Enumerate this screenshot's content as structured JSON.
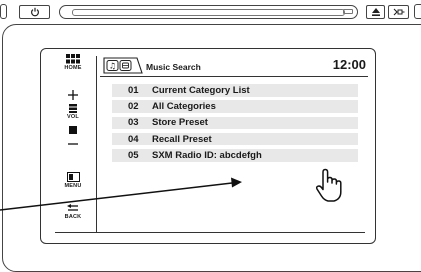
{
  "screen": {
    "header": {
      "title": "Music Search",
      "clock": "12:00"
    },
    "left_menu": [
      {
        "label": "HOME",
        "icon": "home-grid-icon"
      },
      {
        "label": "",
        "icon": "volume-up-icon"
      },
      {
        "label": "VOL",
        "icon": "volume-bars-icon"
      },
      {
        "label": "",
        "icon": "volume-down-icon"
      },
      {
        "label": "MENU",
        "icon": "menu-icon"
      },
      {
        "label": "BACK",
        "icon": "back-arrow-icon"
      }
    ],
    "list": [
      {
        "num": "01",
        "text": "Current Category List"
      },
      {
        "num": "02",
        "text": "All Categories"
      },
      {
        "num": "03",
        "text": "Store Preset"
      },
      {
        "num": "04",
        "text": "Recall Preset"
      },
      {
        "num": "05",
        "text": "SXM Radio ID: abcdefgh"
      }
    ]
  },
  "colors": {
    "outline": "#444444",
    "row_background": "#e8e8e8"
  }
}
